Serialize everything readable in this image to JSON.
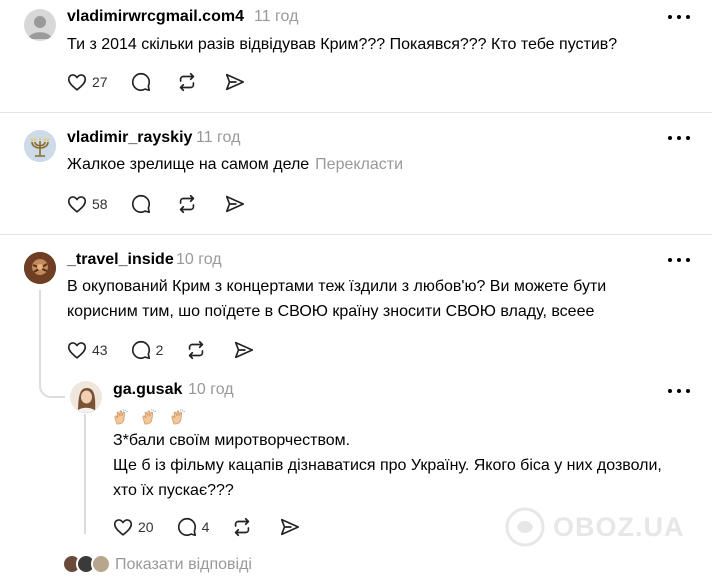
{
  "comments": [
    {
      "username": "vladimirwrcgmail.com4",
      "time": "11 год",
      "text": "Ти з 2014 скільки разів відвідував Крим??? Покаявся??? Кто тебе пустив?",
      "likes": "27"
    },
    {
      "username": "vladimir_rayskiy",
      "time": "11 год",
      "text": "Жалкое зрелище на самом деле",
      "translate_label": "Перекласти",
      "likes": "58"
    },
    {
      "username": "_travel_inside",
      "time": "10 год",
      "text_line1": "В окупований Крим з концертами теж їздили з любов'ю? Ви можете бути",
      "text_line2": "корисним тим, шо поїдете в СВОЮ країну зносити СВОЮ владу, всеее",
      "likes": "43",
      "replies": "2",
      "reply": {
        "username": "ga.gusak",
        "time": "10 год",
        "line1": "З*бали своїм миротворчеством.",
        "line2": "Ще б із фільму кацапів дізнаватися про Україну. Якого біса у них дозволи,",
        "line3": "хто їх пускає???",
        "likes": "20",
        "replies": "4"
      }
    }
  ],
  "show_replies_label": "Показати відповіді",
  "watermark_text": "OBOZ.UA",
  "icons": [
    "heart-icon",
    "comment-icon",
    "repost-icon",
    "share-icon",
    "more-icon",
    "clap-emoji"
  ]
}
